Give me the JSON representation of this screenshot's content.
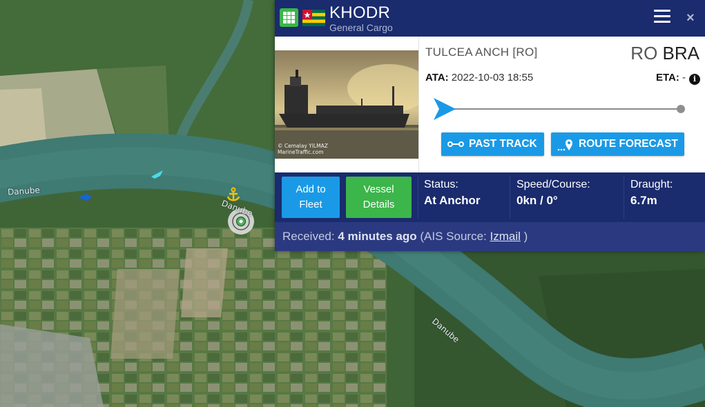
{
  "map": {
    "river_labels": [
      "Danube",
      "Danube",
      "Danube"
    ],
    "colors": {
      "water": "#3f7a73",
      "land": "#4a6b3c"
    }
  },
  "vessel": {
    "name": "KHODR",
    "type": "General Cargo",
    "flag_icon": "togo-flag-icon",
    "photo_credit_line1": "© Cemalay YILMAZ",
    "photo_credit_line2": "MarineTraffic.com"
  },
  "header": {
    "menu_icon": "hamburger-icon",
    "close_label": "×",
    "colors": {
      "background": "#1a2b6e",
      "grid_button": "#3cb54a"
    }
  },
  "voyage": {
    "departure_port": "TULCEA ANCH [RO]",
    "destination_country": "RO",
    "destination_port": "BRA",
    "ata_label": "ATA:",
    "ata_value": "2022-10-03 18:55",
    "eta_label": "ETA:",
    "eta_value": "-",
    "progress": 0
  },
  "actions": {
    "past_track": "PAST TRACK",
    "route_forecast": "ROUTE FORECAST",
    "add_to_fleet_line1": "Add to",
    "add_to_fleet_line2": "Fleet",
    "vessel_details_line1": "Vessel",
    "vessel_details_line2": "Details"
  },
  "stats": {
    "status_label": "Status:",
    "status_value": "At Anchor",
    "speed_label": "Speed/Course:",
    "speed_value": "0kn / 0°",
    "draught_label": "Draught:",
    "draught_value": "6.7m"
  },
  "received": {
    "label": "Received:",
    "value": "4 minutes ago",
    "source_prefix": "(AIS Source:",
    "source_link": "Izmail",
    "source_suffix": ")"
  }
}
